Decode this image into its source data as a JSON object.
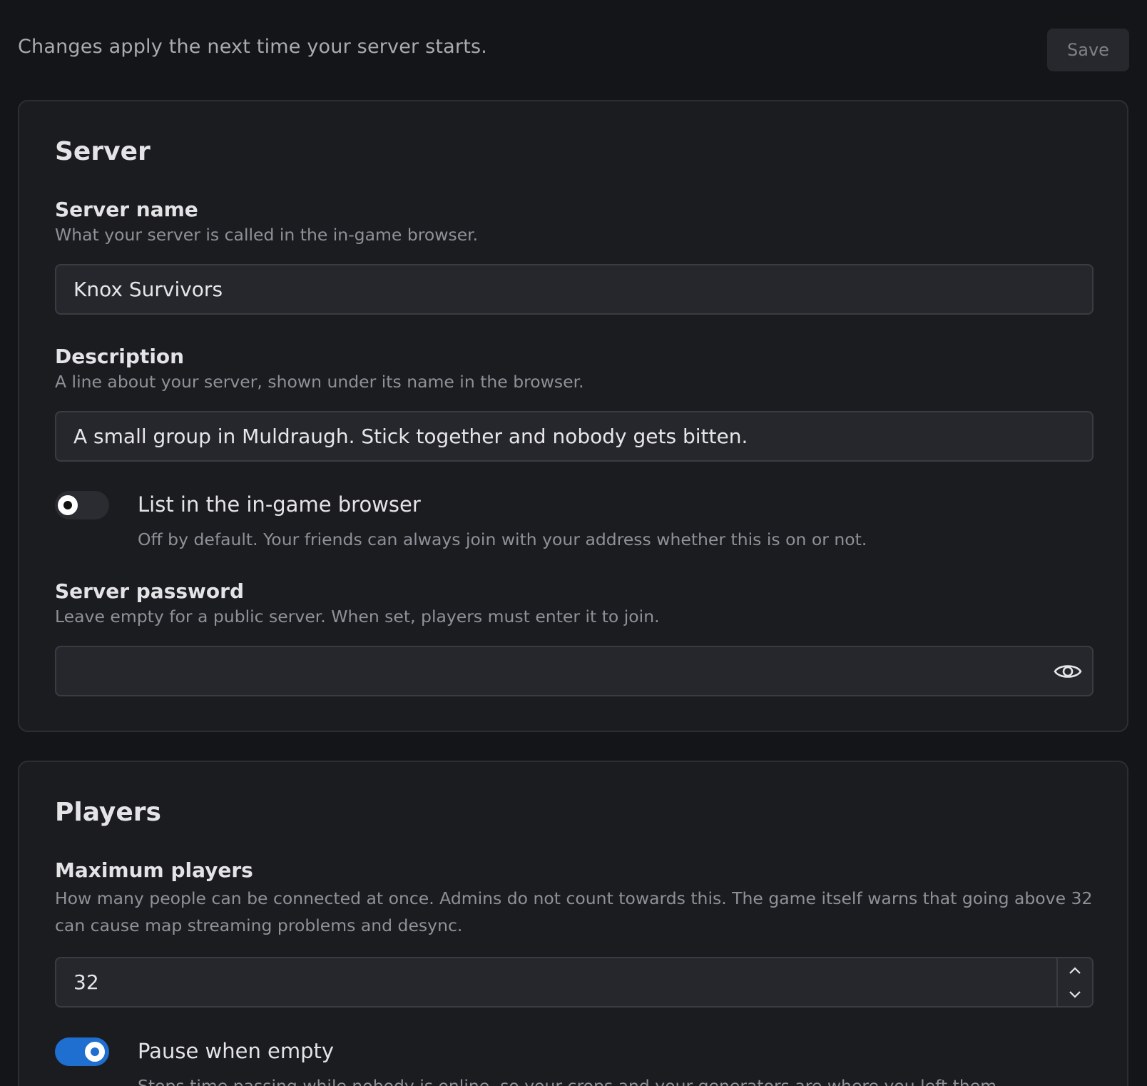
{
  "topbar": {
    "note": "Changes apply the next time your server starts.",
    "save_label": "Save"
  },
  "server_section": {
    "title": "Server",
    "server_name": {
      "label": "Server name",
      "help": "What your server is called in the in-game browser.",
      "value": "Knox Survivors"
    },
    "description": {
      "label": "Description",
      "help": "A line about your server, shown under its name in the browser.",
      "value": "A small group in Muldraugh. Stick together and nobody gets bitten."
    },
    "list_in_browser": {
      "label": "List in the in-game browser",
      "help": "Off by default. Your friends can always join with your address whether this is on or not.",
      "enabled": false
    },
    "password": {
      "label": "Server password",
      "help": "Leave empty for a public server. When set, players must enter it to join.",
      "value": "",
      "reveal_icon": "eye-icon"
    }
  },
  "players_section": {
    "title": "Players",
    "max_players": {
      "label": "Maximum players",
      "help": "How many people can be connected at once. Admins do not count towards this. The game itself warns that going above 32 can cause map streaming problems and desync.",
      "value": "32"
    },
    "pause_when_empty": {
      "label": "Pause when empty",
      "help": "Stops time passing while nobody is online, so your crops and your generators are where you left them.",
      "enabled": true
    }
  },
  "colors": {
    "background": "#141518",
    "card": "#1b1c20",
    "accent": "#1f6fd1"
  }
}
